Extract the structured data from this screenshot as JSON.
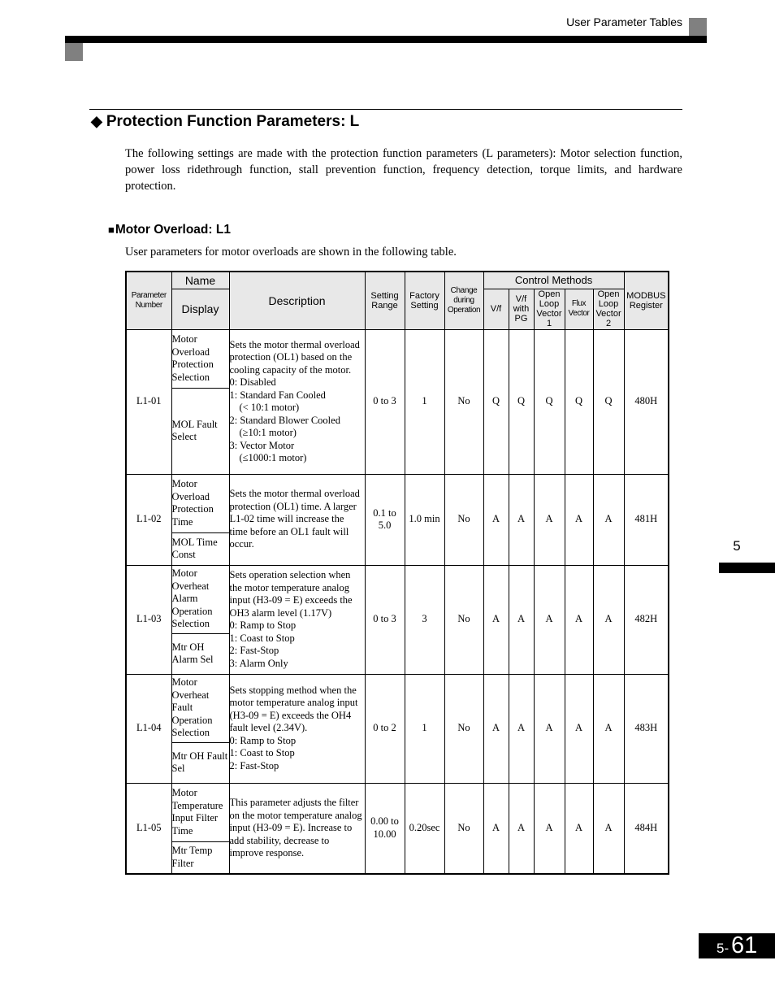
{
  "header": {
    "section_title": "User Parameter Tables"
  },
  "section": {
    "bullet_icon": "diamond-icon",
    "title": "Protection Function Parameters: L",
    "intro": "The following settings are made with the protection function parameters (L parameters): Motor selection function, power loss ridethrough function, stall prevention function, frequency detection, torque limits, and hardware protection."
  },
  "subsection": {
    "bullet_icon": "square-icon",
    "title": "Motor Overload: L1",
    "intro": "User parameters for motor overloads are shown in the following table."
  },
  "table": {
    "headers": {
      "parameter_number": "Parameter Number",
      "name": "Name",
      "display": "Display",
      "description": "Description",
      "setting_range": "Setting Range",
      "factory_setting": "Factory Setting",
      "change_during_operation": "Change during Operation",
      "control_methods": "Control Methods",
      "cm_vf": "V/f",
      "cm_vf_pg": "V/f with PG",
      "cm_olv1": "Open Loop Vector 1",
      "cm_flux": "Flux Vector",
      "cm_olv2": "Open Loop Vector 2",
      "modbus_register": "MODBUS Register"
    },
    "rows": [
      {
        "number": "L1-01",
        "name": "Motor Overload Protection Selection",
        "display": "MOL Fault Select",
        "description": {
          "text": "Sets the motor thermal overload protection (OL1) based on the cooling capacity of the motor.",
          "lines": [
            "0: Disabled",
            "1: Standard Fan Cooled",
            "(< 10:1 motor)",
            "2: Standard Blower Cooled",
            "(≥10:1 motor)",
            "3: Vector Motor",
            "(≤1000:1 motor)"
          ]
        },
        "setting_range": "0 to 3",
        "factory_setting": "1",
        "change_during_operation": "No",
        "control_methods": [
          "Q",
          "Q",
          "Q",
          "Q",
          "Q"
        ],
        "modbus_register": "480H"
      },
      {
        "number": "L1-02",
        "name": "Motor Overload Protection Time",
        "display": "MOL Time Const",
        "description": {
          "text": "Sets the motor thermal overload protection (OL1) time. A larger L1-02 time will increase the time before an OL1 fault will occur.",
          "lines": []
        },
        "setting_range": "0.1 to 5.0",
        "factory_setting": "1.0 min",
        "change_during_operation": "No",
        "control_methods": [
          "A",
          "A",
          "A",
          "A",
          "A"
        ],
        "modbus_register": "481H"
      },
      {
        "number": "L1-03",
        "name": "Motor Overheat Alarm Operation Selection",
        "display": "Mtr OH Alarm Sel",
        "description": {
          "text": "Sets operation selection when the motor temperature analog input (H3-09 = E) exceeds the OH3 alarm level (1.17V)",
          "lines": [
            "0: Ramp to Stop",
            "1: Coast to Stop",
            "2: Fast-Stop",
            "3: Alarm Only"
          ]
        },
        "setting_range": "0 to 3",
        "factory_setting": "3",
        "change_during_operation": "No",
        "control_methods": [
          "A",
          "A",
          "A",
          "A",
          "A"
        ],
        "modbus_register": "482H"
      },
      {
        "number": "L1-04",
        "name": "Motor Overheat Fault Operation Selection",
        "display": "Mtr OH Fault Sel",
        "description": {
          "text": "Sets stopping method when the motor temperature analog input (H3-09 = E) exceeds the OH4 fault level (2.34V).",
          "lines": [
            "0: Ramp to Stop",
            "1: Coast to Stop",
            "2: Fast-Stop"
          ]
        },
        "setting_range": "0 to 2",
        "factory_setting": "1",
        "change_during_operation": "No",
        "control_methods": [
          "A",
          "A",
          "A",
          "A",
          "A"
        ],
        "modbus_register": "483H"
      },
      {
        "number": "L1-05",
        "name": "Motor Temperature Input Filter Time",
        "display": "Mtr Temp Filter",
        "description": {
          "text": "This parameter adjusts the filter on the motor temperature analog input (H3-09 = E). Increase to add stability, decrease to improve response.",
          "lines": []
        },
        "setting_range": "0.00 to 10.00",
        "factory_setting": "0.20sec",
        "change_during_operation": "No",
        "control_methods": [
          "A",
          "A",
          "A",
          "A",
          "A"
        ],
        "modbus_register": "484H"
      }
    ]
  },
  "side_tab": {
    "chapter": "5"
  },
  "footer": {
    "page_prefix": "5-",
    "page_number": "61"
  }
}
